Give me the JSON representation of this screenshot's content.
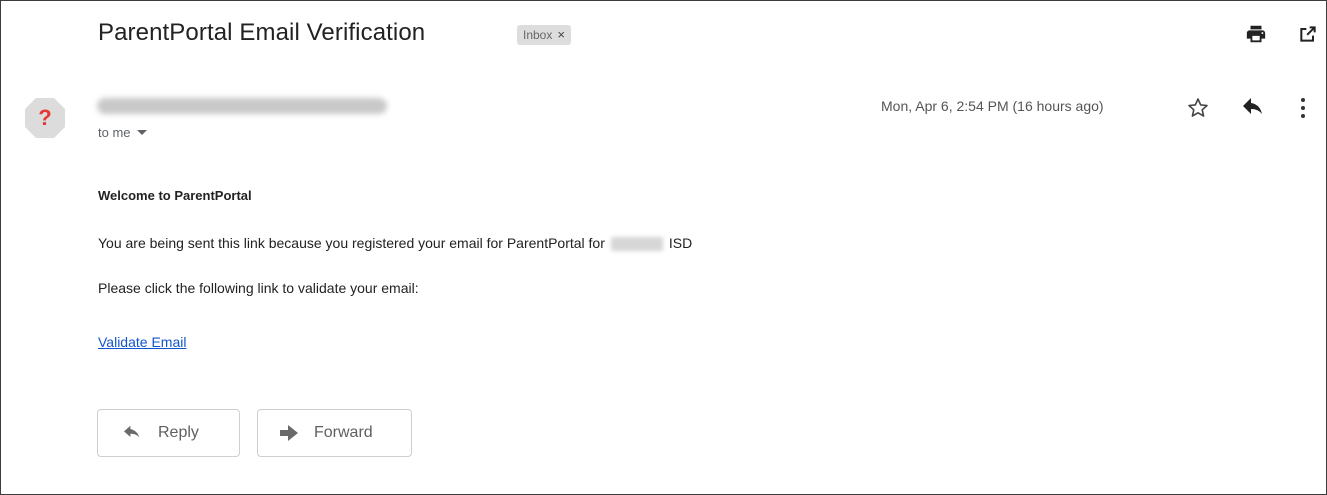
{
  "email": {
    "subject": "ParentPortal Email Verification",
    "label_chip": "Inbox",
    "label_chip_remove": "×",
    "recipient": "to me",
    "date": "Mon, Apr 6, 2:54 PM (16 hours ago)",
    "avatar_glyph": "?",
    "body": {
      "heading": "Welcome to ParentPortal",
      "line1_prefix": "You are being sent this link because you registered your email for ParentPortal for",
      "line1_suffix": "ISD",
      "line2": "Please click the following link to validate your email:",
      "link": "Validate Email"
    },
    "actions": {
      "reply": "Reply",
      "forward": "Forward"
    }
  },
  "icons": {
    "print": "print-icon",
    "open_new_window": "open-in-new-window-icon",
    "star": "star-icon",
    "reply": "reply-icon",
    "more": "more-vertical-icon",
    "dropdown": "chevron-down-icon",
    "forward": "forward-icon"
  },
  "colors": {
    "link": "#1155cc",
    "avatar_accent": "#e53935",
    "chip_bg": "#dddddd"
  }
}
